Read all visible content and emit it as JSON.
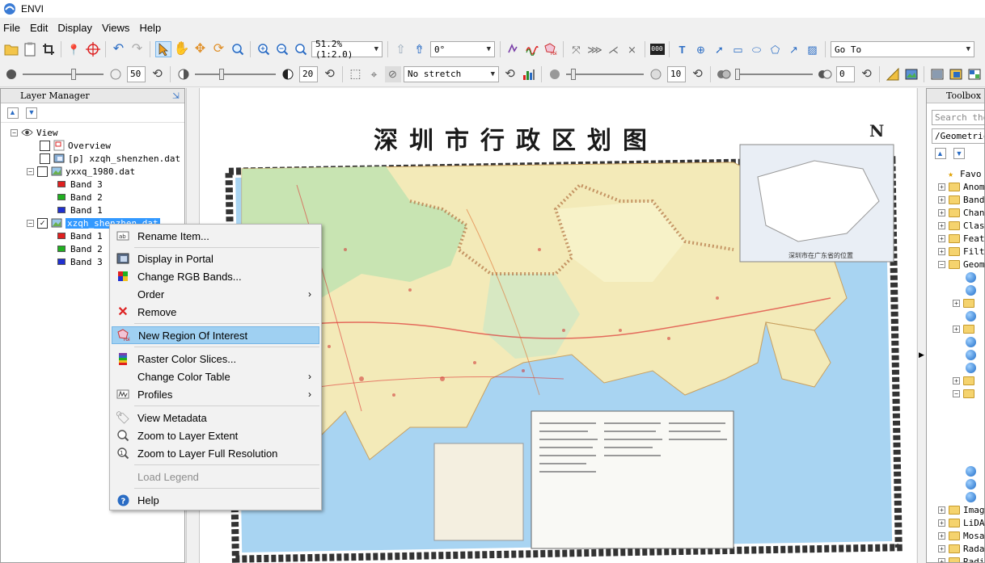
{
  "app": {
    "title": "ENVI"
  },
  "menu": [
    "File",
    "Edit",
    "Display",
    "Views",
    "Help"
  ],
  "toolbar1": {
    "zoom_value": "51.2% (1:2.0)",
    "rotation_value": "0°",
    "goto_placeholder": "Go To"
  },
  "toolbar2": {
    "brightness": "50",
    "contrast": "20",
    "stretch": "No stretch",
    "sharpen": "10",
    "transparency": "0"
  },
  "layer_manager": {
    "title": "Layer Manager",
    "root": "View",
    "items": [
      "Overview",
      "[p] xzqh_shenzhen.dat",
      "yxxq_1980.dat",
      "Band 3",
      "Band 2",
      "Band 1",
      "xzqh_shenzhen.dat",
      "Band 1",
      "Band 2",
      "Band 3"
    ]
  },
  "context_menu": {
    "items": [
      "Rename Item...",
      "Display in Portal",
      "Change RGB Bands...",
      "Order",
      "Remove",
      "New Region Of Interest",
      "Raster Color Slices...",
      "Change Color Table",
      "Profiles",
      "View Metadata",
      "Zoom to Layer Extent",
      "Zoom to Layer Full Resolution",
      "Load Legend",
      "Help"
    ]
  },
  "map": {
    "title": "深圳市行政区划图",
    "north": "N",
    "inset_caption": "深圳市在广东省的位置"
  },
  "toolbox": {
    "title": "Toolbox",
    "search_placeholder": "Search the",
    "path": "/Geometric",
    "folders": [
      "Favo",
      "Anom",
      "Band",
      "Chan",
      "Clas",
      "Feat",
      "Filt",
      "Geom",
      "Imag",
      "LiDA",
      "Mosa",
      "Rada",
      "Radi"
    ]
  },
  "colors": {
    "highlight": "#9fd0f2",
    "selection": "#3399ff",
    "sea": "#a8d4f2",
    "land": "#f3eab8"
  }
}
